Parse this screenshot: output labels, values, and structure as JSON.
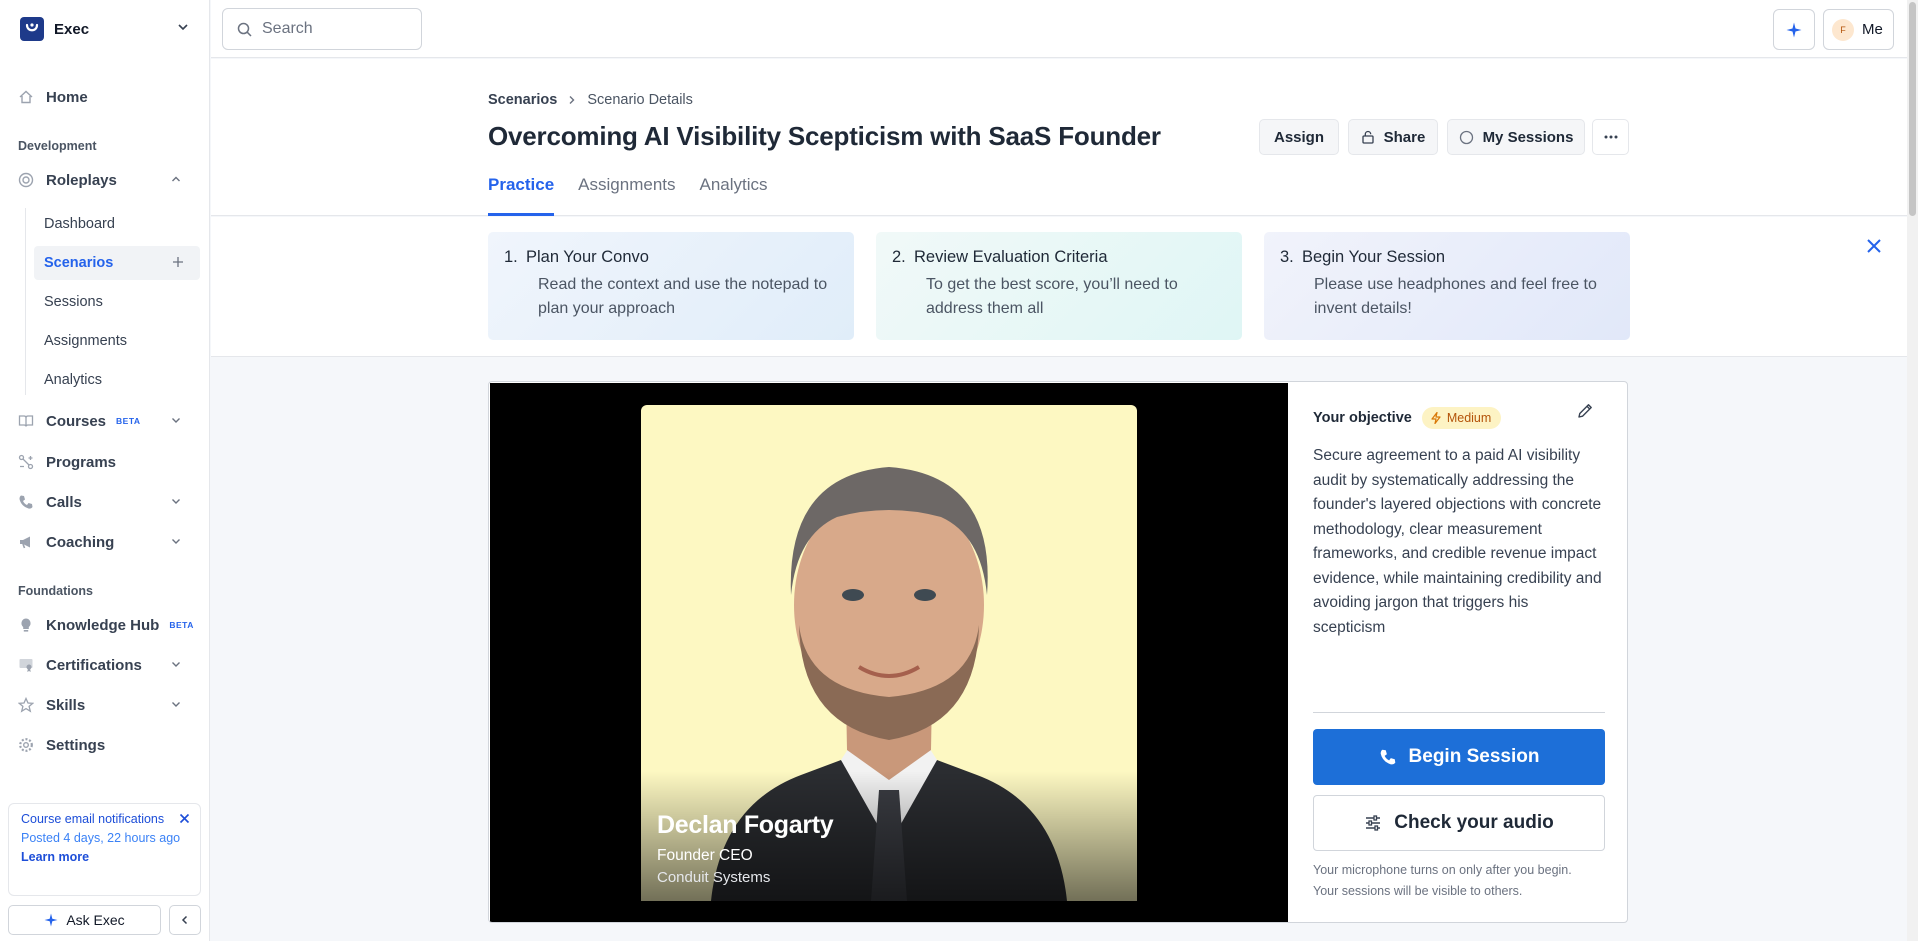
{
  "workspace": {
    "name": "Exec"
  },
  "search": {
    "placeholder": "Search"
  },
  "topbar": {
    "avatar_initial": "F",
    "me_label": "Me"
  },
  "nav": {
    "home": "Home",
    "section_development": "Development",
    "roleplays": "Roleplays",
    "roleplays_sub": [
      "Dashboard",
      "Scenarios",
      "Sessions",
      "Assignments",
      "Analytics"
    ],
    "courses": "Courses",
    "beta": "BETA",
    "programs": "Programs",
    "calls": "Calls",
    "coaching": "Coaching",
    "section_foundations": "Foundations",
    "knowledge_hub": "Knowledge Hub",
    "certifications": "Certifications",
    "skills": "Skills",
    "settings": "Settings"
  },
  "notification": {
    "title": "Course email notifications",
    "posted": "Posted 4 days, 22 hours ago",
    "link": "Learn more"
  },
  "ask": {
    "label": "Ask Exec"
  },
  "breadcrumb": {
    "root": "Scenarios",
    "current": "Scenario Details"
  },
  "page": {
    "title": "Overcoming AI Visibility Scepticism with SaaS Founder"
  },
  "actions": {
    "assign": "Assign",
    "share": "Share",
    "sessions": "My Sessions"
  },
  "tabs": [
    "Practice",
    "Assignments",
    "Analytics"
  ],
  "steps": [
    {
      "num": "1.",
      "title": "Plan Your Convo",
      "body": "Read the context and use the notepad to plan your approach"
    },
    {
      "num": "2.",
      "title": "Review Evaluation Criteria",
      "body": "To get the best score, you’ll need to address them all"
    },
    {
      "num": "3.",
      "title": "Begin Your Session",
      "body": "Please use headphones and feel free to invent details!"
    }
  ],
  "persona": {
    "name": "Declan Fogarty",
    "role": "Founder CEO",
    "company": "Conduit Systems"
  },
  "objective": {
    "label": "Your objective",
    "difficulty": "Medium",
    "text": "Secure agreement to a paid AI visibility audit by systematically addressing the founder's layered objections with concrete methodology, clear measurement frameworks, and credible revenue impact evidence, while maintaining credibility and avoiding jargon that triggers his scepticism"
  },
  "session": {
    "begin": "Begin Session",
    "audio": "Check your audio",
    "note1": "Your microphone turns on only after you begin.",
    "note2": "Your sessions will be visible to others."
  },
  "colors": {
    "accent": "#2563eb",
    "primary_button": "#1d6fd8",
    "brand": "#1e3a8a",
    "portrait_bg": "#fdf8c2"
  }
}
